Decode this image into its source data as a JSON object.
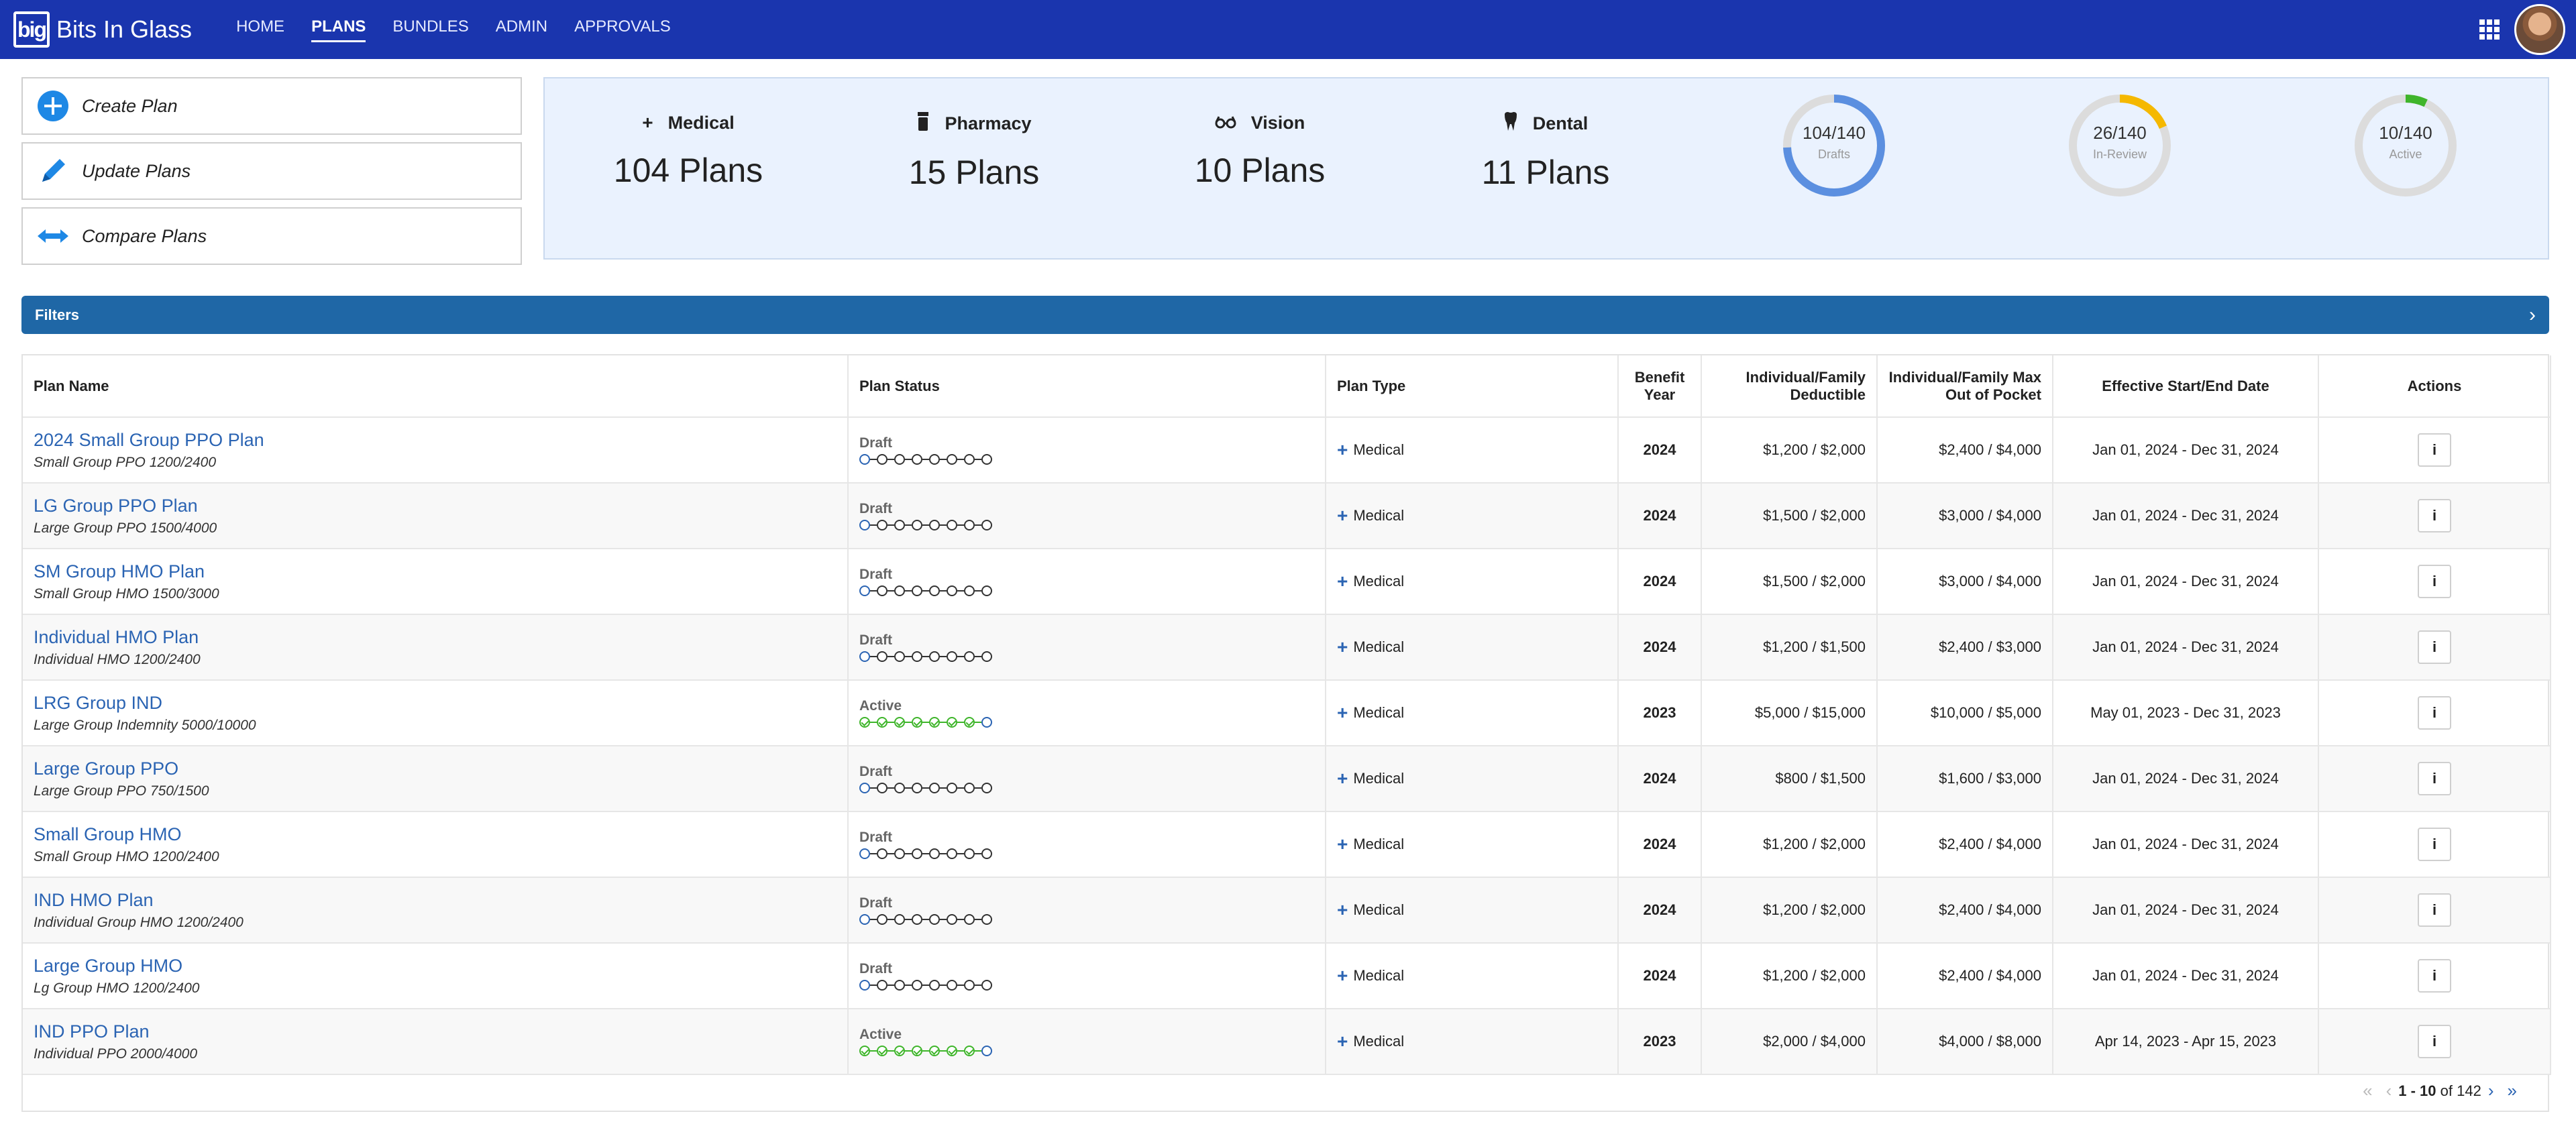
{
  "app": {
    "logo": "big",
    "name": "Bits In Glass"
  },
  "nav": [
    {
      "label": "HOME",
      "active": false
    },
    {
      "label": "PLANS",
      "active": true
    },
    {
      "label": "BUNDLES",
      "active": false
    },
    {
      "label": "ADMIN",
      "active": false
    },
    {
      "label": "APPROVALS",
      "active": false
    }
  ],
  "actions": {
    "create": "Create Plan",
    "update": "Update Plans",
    "compare": "Compare Plans"
  },
  "summary": {
    "medical": {
      "label": "Medical",
      "value": "104 Plans",
      "icon": "plus-icon"
    },
    "pharmacy": {
      "label": "Pharmacy",
      "value": "15 Plans",
      "icon": "pill-bottle-icon"
    },
    "vision": {
      "label": "Vision",
      "value": "10 Plans",
      "icon": "glasses-icon"
    },
    "dental": {
      "label": "Dental",
      "value": "11 Plans",
      "icon": "tooth-icon"
    }
  },
  "gauges": {
    "drafts": {
      "num": "104/140",
      "label": "Drafts",
      "fraction": 0.743,
      "color": "#5b8fe0"
    },
    "review": {
      "num": "26/140",
      "label": "In-Review",
      "fraction": 0.186,
      "color": "#f5b800"
    },
    "active": {
      "num": "10/140",
      "label": "Active",
      "fraction": 0.071,
      "color": "#3fb52b"
    }
  },
  "filters": {
    "title": "Filters"
  },
  "table": {
    "headers": {
      "name": "Plan Name",
      "status": "Plan Status",
      "type": "Plan Type",
      "year": "Benefit Year",
      "deductible": "Individual/Family Deductible",
      "oop": "Individual/Family Max Out of Pocket",
      "dates": "Effective Start/End Date",
      "actions": "Actions"
    },
    "rows": [
      {
        "name": "2024 Small Group PPO Plan",
        "sub": "Small Group PPO 1200/2400",
        "status": "Draft",
        "type": "Medical",
        "year": "2024",
        "deductible": "$1,200 / $2,000",
        "oop": "$2,400 / $4,000",
        "dates": "Jan 01, 2024 - Dec 31, 2024"
      },
      {
        "name": "LG Group PPO Plan",
        "sub": "Large Group PPO 1500/4000",
        "status": "Draft",
        "type": "Medical",
        "year": "2024",
        "deductible": "$1,500 / $2,000",
        "oop": "$3,000 / $4,000",
        "dates": "Jan 01, 2024 - Dec 31, 2024"
      },
      {
        "name": "SM Group HMO Plan",
        "sub": "Small Group HMO 1500/3000",
        "status": "Draft",
        "type": "Medical",
        "year": "2024",
        "deductible": "$1,500 / $2,000",
        "oop": "$3,000 / $4,000",
        "dates": "Jan 01, 2024 - Dec 31, 2024"
      },
      {
        "name": "Individual HMO Plan",
        "sub": "Individual HMO 1200/2400",
        "status": "Draft",
        "type": "Medical",
        "year": "2024",
        "deductible": "$1,200 / $1,500",
        "oop": "$2,400 / $3,000",
        "dates": "Jan 01, 2024 - Dec 31, 2024"
      },
      {
        "name": "LRG Group IND",
        "sub": "Large Group Indemnity 5000/10000",
        "status": "Active",
        "type": "Medical",
        "year": "2023",
        "deductible": "$5,000 / $15,000",
        "oop": "$10,000 / $5,000",
        "dates": "May 01, 2023 - Dec 31, 2023"
      },
      {
        "name": "Large Group PPO",
        "sub": "Large Group PPO 750/1500",
        "status": "Draft",
        "type": "Medical",
        "year": "2024",
        "deductible": "$800 / $1,500",
        "oop": "$1,600 / $3,000",
        "dates": "Jan 01, 2024 - Dec 31, 2024"
      },
      {
        "name": "Small Group HMO",
        "sub": "Small Group HMO 1200/2400",
        "status": "Draft",
        "type": "Medical",
        "year": "2024",
        "deductible": "$1,200 / $2,000",
        "oop": "$2,400 / $4,000",
        "dates": "Jan 01, 2024 - Dec 31, 2024"
      },
      {
        "name": "IND HMO Plan",
        "sub": "Individual Group HMO 1200/2400",
        "status": "Draft",
        "type": "Medical",
        "year": "2024",
        "deductible": "$1,200 / $2,000",
        "oop": "$2,400 / $4,000",
        "dates": "Jan 01, 2024 - Dec 31, 2024"
      },
      {
        "name": "Large Group HMO",
        "sub": "Lg Group HMO 1200/2400",
        "status": "Draft",
        "type": "Medical",
        "year": "2024",
        "deductible": "$1,200 / $2,000",
        "oop": "$2,400 / $4,000",
        "dates": "Jan 01, 2024 - Dec 31, 2024"
      },
      {
        "name": "IND PPO Plan",
        "sub": "Individual PPO 2000/4000",
        "status": "Active",
        "type": "Medical",
        "year": "2023",
        "deductible": "$2,000 / $4,000",
        "oop": "$4,000 / $8,000",
        "dates": "Apr 14, 2023 - Apr 15, 2023"
      }
    ]
  },
  "pagination": {
    "range": "1 - 10",
    "of": "of",
    "total": "142"
  }
}
